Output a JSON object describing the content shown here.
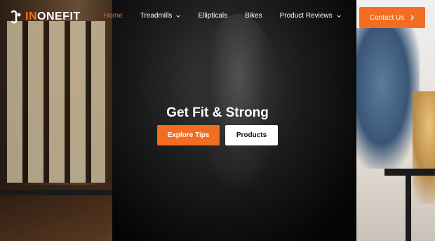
{
  "brand": {
    "prefix": "IN",
    "name": "ONEFIT",
    "accent_color": "#f26d21"
  },
  "nav": {
    "items": [
      {
        "label": "Home",
        "active": true,
        "has_dropdown": false
      },
      {
        "label": "Treadmills",
        "active": false,
        "has_dropdown": true
      },
      {
        "label": "Ellipticals",
        "active": false,
        "has_dropdown": false
      },
      {
        "label": "Bikes",
        "active": false,
        "has_dropdown": false
      },
      {
        "label": "Product Reviews",
        "active": false,
        "has_dropdown": true
      }
    ]
  },
  "header": {
    "contact_label": "Contact Us",
    "contact_icon": "chevron-right-icon"
  },
  "hero": {
    "headline": "Get Fit & Strong",
    "primary_cta": "Explore Tips",
    "secondary_cta": "Products"
  }
}
